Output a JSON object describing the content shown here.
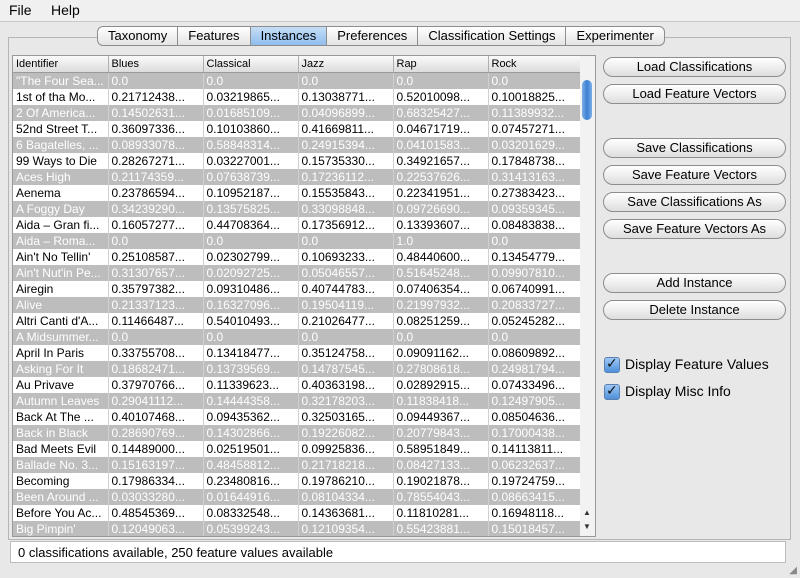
{
  "menu": {
    "file": "File",
    "help": "Help"
  },
  "tabs": [
    {
      "label": "Taxonomy"
    },
    {
      "label": "Features"
    },
    {
      "label": "Instances",
      "active": true
    },
    {
      "label": "Preferences"
    },
    {
      "label": "Classification Settings"
    },
    {
      "label": "Experimenter"
    }
  ],
  "table": {
    "columns": [
      "Identifier",
      "Blues",
      "Classical",
      "Jazz",
      "Rap",
      "Rock"
    ],
    "rows": [
      {
        "misc": true,
        "cells": [
          "\"The Four Sea...",
          "0.0",
          "0.0",
          "0.0",
          "0.0",
          "0.0"
        ]
      },
      {
        "misc": false,
        "cells": [
          "1st of tha Mo...",
          "0.21712438...",
          "0.03219865...",
          "0.13038771...",
          "0.52010098...",
          "0.10018825..."
        ]
      },
      {
        "misc": true,
        "cells": [
          "2 Of America...",
          "0.14502631...",
          "0.01685109...",
          "0.04096899...",
          "0.68325427...",
          "0.11389932..."
        ]
      },
      {
        "misc": false,
        "cells": [
          "52nd Street T...",
          "0.36097336...",
          "0.10103860...",
          "0.41669811...",
          "0.04671719...",
          "0.07457271..."
        ]
      },
      {
        "misc": true,
        "cells": [
          "6 Bagatelles, ...",
          "0.08933078...",
          "0.58848314...",
          "0.24915394...",
          "0.04101583...",
          "0.03201629..."
        ]
      },
      {
        "misc": false,
        "cells": [
          "99 Ways to Die",
          "0.28267271...",
          "0.03227001...",
          "0.15735330...",
          "0.34921657...",
          "0.17848738..."
        ]
      },
      {
        "misc": true,
        "cells": [
          "Aces High",
          "0.21174359...",
          "0.07638739...",
          "0.17236112...",
          "0.22537626...",
          "0.31413163..."
        ]
      },
      {
        "misc": false,
        "cells": [
          "Aenema",
          "0.23786594...",
          "0.10952187...",
          "0.15535843...",
          "0.22341951...",
          "0.27383423..."
        ]
      },
      {
        "misc": true,
        "cells": [
          "A Foggy Day",
          "0.34239290...",
          "0.13575825...",
          "0.33098848...",
          "0.09726690...",
          "0.09359345..."
        ]
      },
      {
        "misc": false,
        "cells": [
          "Aida – Gran fi...",
          "0.16057277...",
          "0.44708364...",
          "0.17356912...",
          "0.13393607...",
          "0.08483838..."
        ]
      },
      {
        "misc": true,
        "cells": [
          "Aida – Roma...",
          "0.0",
          "0.0",
          "0.0",
          "1.0",
          "0.0"
        ]
      },
      {
        "misc": false,
        "cells": [
          "Ain't No Tellin'",
          "0.25108587...",
          "0.02302799...",
          "0.10693233...",
          "0.48440600...",
          "0.13454779..."
        ]
      },
      {
        "misc": true,
        "cells": [
          "Ain't Nut'in Pe...",
          "0.31307657...",
          "0.02092725...",
          "0.05046557...",
          "0.51645248...",
          "0.09907810..."
        ]
      },
      {
        "misc": false,
        "cells": [
          "Airegin",
          "0.35797382...",
          "0.09310486...",
          "0.40744783...",
          "0.07406354...",
          "0.06740991..."
        ]
      },
      {
        "misc": true,
        "cells": [
          "Alive",
          "0.21337123...",
          "0.16327096...",
          "0.19504119...",
          "0.21997932...",
          "0.20833727..."
        ]
      },
      {
        "misc": false,
        "cells": [
          "Altri Canti d'A...",
          "0.11466487...",
          "0.54010493...",
          "0.21026477...",
          "0.08251259...",
          "0.05245282..."
        ]
      },
      {
        "misc": true,
        "cells": [
          "A Midsummer...",
          "0.0",
          "0.0",
          "0.0",
          "0.0",
          "0.0"
        ]
      },
      {
        "misc": false,
        "cells": [
          "April In Paris",
          "0.33755708...",
          "0.13418477...",
          "0.35124758...",
          "0.09091162...",
          "0.08609892..."
        ]
      },
      {
        "misc": true,
        "cells": [
          "Asking For It",
          "0.18682471...",
          "0.13739569...",
          "0.14787545...",
          "0.27808618...",
          "0.24981794..."
        ]
      },
      {
        "misc": false,
        "cells": [
          "Au Privave",
          "0.37970766...",
          "0.11339623...",
          "0.40363198...",
          "0.02892915...",
          "0.07433496..."
        ]
      },
      {
        "misc": true,
        "cells": [
          "Autumn Leaves",
          "0.29041112...",
          "0.14444358...",
          "0.32178203...",
          "0.11838418...",
          "0.12497905..."
        ]
      },
      {
        "misc": false,
        "cells": [
          "Back At The ...",
          "0.40107468...",
          "0.09435362...",
          "0.32503165...",
          "0.09449367...",
          "0.08504636..."
        ]
      },
      {
        "misc": true,
        "cells": [
          "Back in Black",
          "0.28690769...",
          "0.14302866...",
          "0.19226082...",
          "0.20779843...",
          "0.17000438..."
        ]
      },
      {
        "misc": false,
        "cells": [
          "Bad Meets Evil",
          "0.14489000...",
          "0.02519501...",
          "0.09925836...",
          "0.58951849...",
          "0.14113811..."
        ]
      },
      {
        "misc": true,
        "cells": [
          "Ballade No. 3...",
          "0.15163197...",
          "0.48458812...",
          "0.21718218...",
          "0.08427133...",
          "0.06232637..."
        ]
      },
      {
        "misc": false,
        "cells": [
          "Becoming",
          "0.17986334...",
          "0.23480816...",
          "0.19786210...",
          "0.19021878...",
          "0.19724759..."
        ]
      },
      {
        "misc": true,
        "cells": [
          "Been Around ...",
          "0.03033280...",
          "0.01644916...",
          "0.08104334...",
          "0.78554043...",
          "0.08663415..."
        ]
      },
      {
        "misc": false,
        "cells": [
          "Before You Ac...",
          "0.48545369...",
          "0.08332548...",
          "0.14363681...",
          "0.11810281...",
          "0.16948118..."
        ]
      },
      {
        "misc": true,
        "cells": [
          "Big Pimpin'",
          "0.12049063...",
          "0.05399243...",
          "0.12109354...",
          "0.55423881...",
          "0.15018457..."
        ]
      }
    ]
  },
  "buttons": {
    "load_classifications": "Load Classifications",
    "load_feature_vectors": "Load Feature Vectors",
    "save_classifications": "Save Classifications",
    "save_feature_vectors": "Save Feature Vectors",
    "save_classifications_as": "Save Classifications As",
    "save_feature_vectors_as": "Save Feature Vectors As",
    "add_instance": "Add Instance",
    "delete_instance": "Delete Instance"
  },
  "checkboxes": {
    "display_feature_values": {
      "label": "Display Feature Values",
      "checked": true
    },
    "display_misc_info": {
      "label": "Display Misc Info",
      "checked": true
    }
  },
  "status": "0 classifications available, 250 feature values available",
  "colors": {
    "active_tab": "#8fbdee",
    "misc_row": "#bdbdbd",
    "scroll_thumb": "#3d7fd1"
  }
}
